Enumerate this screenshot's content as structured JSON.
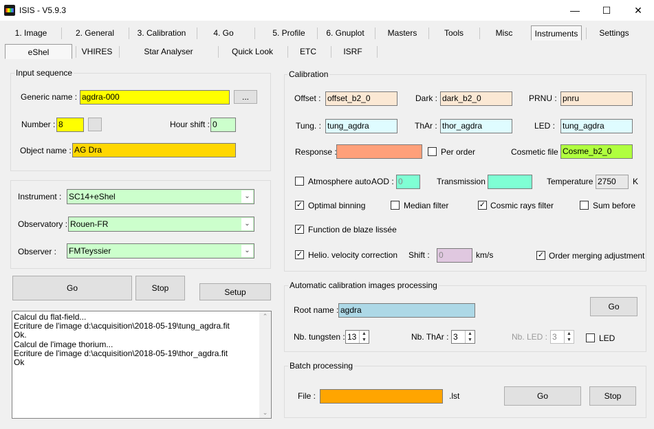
{
  "window": {
    "title": "ISIS - V5.9.3",
    "min_glyph": "—",
    "max_glyph": "☐",
    "close_glyph": "✕"
  },
  "main_tabs": [
    {
      "label": "1. Image"
    },
    {
      "label": "2. General"
    },
    {
      "label": "3. Calibration"
    },
    {
      "label": "4. Go"
    },
    {
      "label": "5. Profile"
    },
    {
      "label": "6. Gnuplot"
    },
    {
      "label": "Masters"
    },
    {
      "label": "Tools"
    },
    {
      "label": "Misc"
    },
    {
      "label": "Instruments",
      "active": true
    },
    {
      "label": "Settings"
    }
  ],
  "sub_tabs": [
    {
      "label": "eShel",
      "active": true
    },
    {
      "label": "VHIRES"
    },
    {
      "label": "Star Analyser"
    },
    {
      "label": "Quick Look"
    },
    {
      "label": "ETC"
    },
    {
      "label": "ISRF"
    }
  ],
  "input_sequence": {
    "title": "Input sequence",
    "generic_name_label": "Generic name :",
    "generic_name_value": "agdra-000",
    "browse_label": "...",
    "number_label": "Number :",
    "number_value": "8",
    "hour_shift_label": "Hour shift :",
    "hour_shift_value": "0",
    "object_name_label": "Object name :",
    "object_name_value": "AG Dra"
  },
  "setup_box": {
    "instrument_label": "Instrument :",
    "instrument_value": "SC14+eShel",
    "observatory_label": "Observatory :",
    "observatory_value": "Rouen-FR",
    "observer_label": "Observer :",
    "observer_value": "FMTeyssier"
  },
  "actions": {
    "go_label": "Go",
    "stop_label": "Stop",
    "setup_label": "Setup"
  },
  "log_lines": [
    "Calcul du flat-field...",
    "Ecriture de l'image d:\\acquisition\\2018-05-19\\tung_agdra.fit",
    "Ok.",
    "Calcul de l'image thorium...",
    "Ecriture de l'image d:\\acquisition\\2018-05-19\\thor_agdra.fit",
    "Ok"
  ],
  "calibration": {
    "title": "Calibration",
    "offset_label": "Offset :",
    "offset_value": "offset_b2_0",
    "dark_label": "Dark :",
    "dark_value": "dark_b2_0",
    "prnu_label": "PRNU :",
    "prnu_value": "pnru",
    "tung_label": "Tung. :",
    "tung_value": "tung_agdra",
    "thar_label": "ThAr :",
    "thar_value": "thor_agdra",
    "led_label": "LED :",
    "led_value": "tung_agdra",
    "response_label": "Response :",
    "response_value": "",
    "per_order_label": "Per order",
    "per_order_checked": false,
    "cosmetic_label": "Cosmetic file :",
    "cosmetic_value": "Cosme_b2_0",
    "atmosphere_label": "Atmosphere auto.",
    "atmosphere_checked": false,
    "aod_label": "AOD :",
    "aod_value": "0",
    "transmission_label": "Transmission :",
    "transmission_value": "",
    "temperature_label": "Temperature :",
    "temperature_value": "2750",
    "temperature_unit": "K",
    "optimal_binning_label": "Optimal binning",
    "optimal_binning_checked": true,
    "median_filter_label": "Median filter",
    "median_filter_checked": false,
    "cosmic_rays_label": "Cosmic rays filter",
    "cosmic_rays_checked": true,
    "sum_before_label": "Sum before",
    "sum_before_checked": false,
    "blaze_label": "Function de blaze lissée",
    "blaze_checked": true,
    "helio_label": "Helio. velocity correction",
    "helio_checked": true,
    "shift_label": "Shift :",
    "shift_value": "0",
    "shift_unit": "km/s",
    "order_merging_label": "Order merging adjustment",
    "order_merging_checked": true
  },
  "auto_calib": {
    "title": "Automatic calibration images processing",
    "root_name_label": "Root name :",
    "root_name_value": "agdra",
    "go_label": "Go",
    "nb_tungsten_label": "Nb. tungsten :",
    "nb_tungsten_value": "13",
    "nb_thar_label": "Nb. ThAr :",
    "nb_thar_value": "3",
    "nb_led_label": "Nb. LED :",
    "nb_led_value": "3",
    "led_label": "LED",
    "led_checked": false
  },
  "batch": {
    "title": "Batch processing",
    "file_label": "File :",
    "file_value": "",
    "file_ext": ".lst",
    "go_label": "Go",
    "stop_label": "Stop"
  },
  "colors": {
    "yellow": "#ffff00",
    "gold": "#ffd700",
    "orange": "#ffa500",
    "bisque": "#fbe8d4",
    "light_cyan": "#dffcff",
    "salmon": "#ffa07a",
    "lime": "#b0ff3f",
    "aquamarine": "#7fffd4",
    "light_blue": "#add8e6",
    "thistle": "#e0c8e0",
    "pale_green": "#ccffcc"
  }
}
